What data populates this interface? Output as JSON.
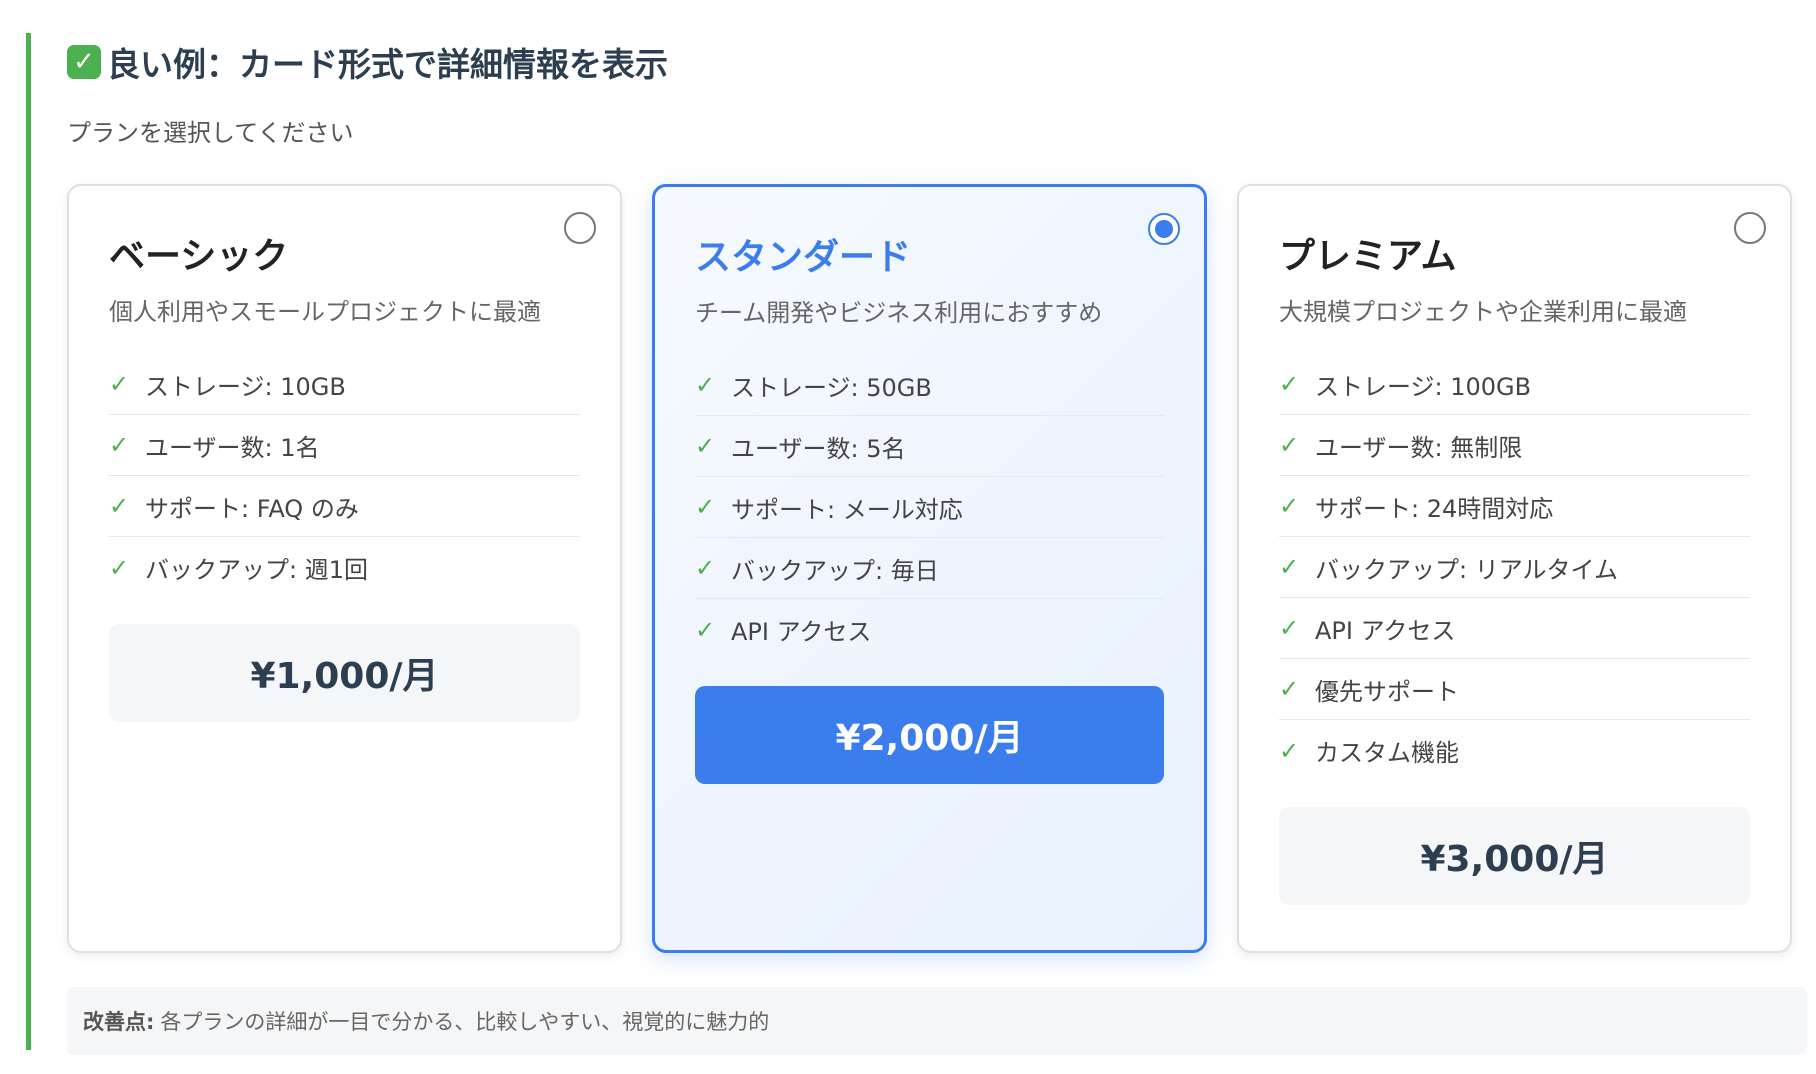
{
  "heading": {
    "icon": "check-mark-button-icon",
    "text": "良い例：カード形式で詳細情報を表示",
    "accent_color": "#4caf50"
  },
  "prompt": "プランを選択してください",
  "plans": [
    {
      "name": "ベーシック",
      "description": "個人利用やスモールプロジェクトに最適",
      "selected": false,
      "features": [
        "ストレージ: 10GB",
        "ユーザー数: 1名",
        "サポート: FAQ のみ",
        "バックアップ: 週1回"
      ],
      "price": "¥1,000/月"
    },
    {
      "name": "スタンダード",
      "description": "チーム開発やビジネス利用におすすめ",
      "selected": true,
      "features": [
        "ストレージ: 50GB",
        "ユーザー数: 5名",
        "サポート: メール対応",
        "バックアップ: 毎日",
        "API アクセス"
      ],
      "price": "¥2,000/月"
    },
    {
      "name": "プレミアム",
      "description": "大規模プロジェクトや企業利用に最適",
      "selected": false,
      "features": [
        "ストレージ: 100GB",
        "ユーザー数: 無制限",
        "サポート: 24時間対応",
        "バックアップ: リアルタイム",
        "API アクセス",
        "優先サポート",
        "カスタム機能"
      ],
      "price": "¥3,000/月"
    }
  ],
  "feature_icon": "check-icon",
  "selected_color": "#3b7ded",
  "note": {
    "label": "改善点:",
    "text": "各プランの詳細が一目で分かる、比較しやすい、視覚的に魅力的"
  }
}
